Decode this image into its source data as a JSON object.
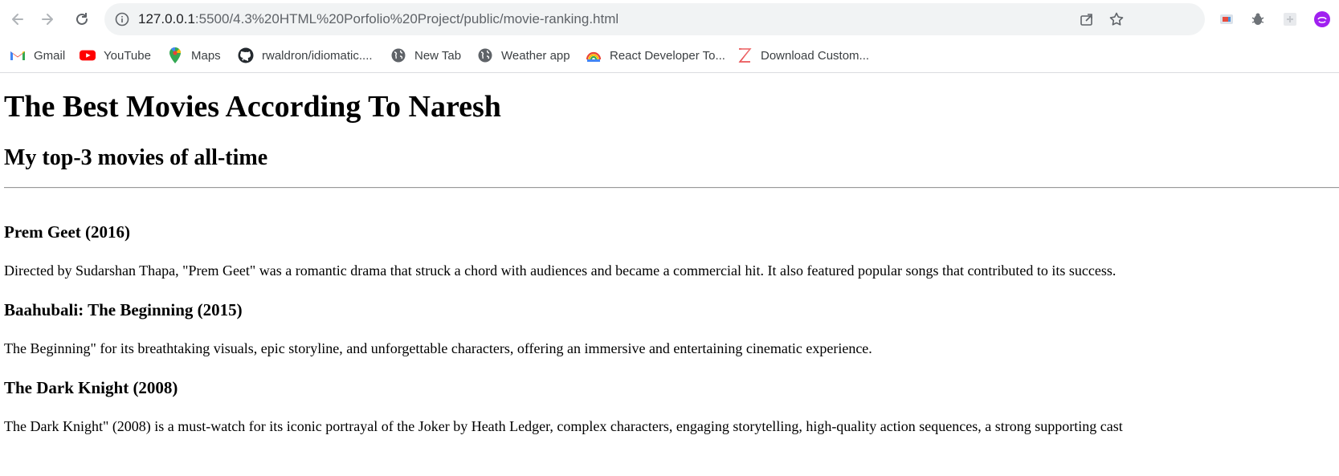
{
  "browser": {
    "url_host": "127.0.0.1",
    "url_path": ":5500/4.3%20HTML%20Porfolio%20Project/public/movie-ranking.html"
  },
  "bookmarks": [
    {
      "label": "Gmail",
      "icon": "gmail-icon"
    },
    {
      "label": "YouTube",
      "icon": "youtube-icon"
    },
    {
      "label": "Maps",
      "icon": "maps-icon"
    },
    {
      "label": "rwaldron/idiomatic....",
      "icon": "github-icon"
    },
    {
      "label": "New Tab",
      "icon": "globe-icon"
    },
    {
      "label": "Weather app",
      "icon": "globe-icon"
    },
    {
      "label": "React Developer To...",
      "icon": "rainbow-icon"
    },
    {
      "label": "Download Custom...",
      "icon": "z-logo-icon"
    }
  ],
  "page": {
    "title": "The Best Movies According To Naresh",
    "subtitle": "My top-3 movies of all-time",
    "movies": [
      {
        "heading": "Prem Geet (2016)",
        "description": "Directed by Sudarshan Thapa, \"Prem Geet\" was a romantic drama that struck a chord with audiences and became a commercial hit. It also featured popular songs that contributed to its success."
      },
      {
        "heading": "Baahubali: The Beginning (2015)",
        "description": "The Beginning\" for its breathtaking visuals, epic storyline, and unforgettable characters, offering an immersive and entertaining cinematic experience."
      },
      {
        "heading": "The Dark Knight (2008)",
        "description": "The Dark Knight\" (2008) is a must-watch for its iconic portrayal of the Joker by Heath Ledger, complex characters, engaging storytelling, high-quality action sequences, a strong supporting cast"
      }
    ]
  },
  "colors": {
    "chrome_omnibox": "#f1f3f4",
    "profile_avatar": "#a020f0",
    "youtube_red": "#ff0000"
  }
}
